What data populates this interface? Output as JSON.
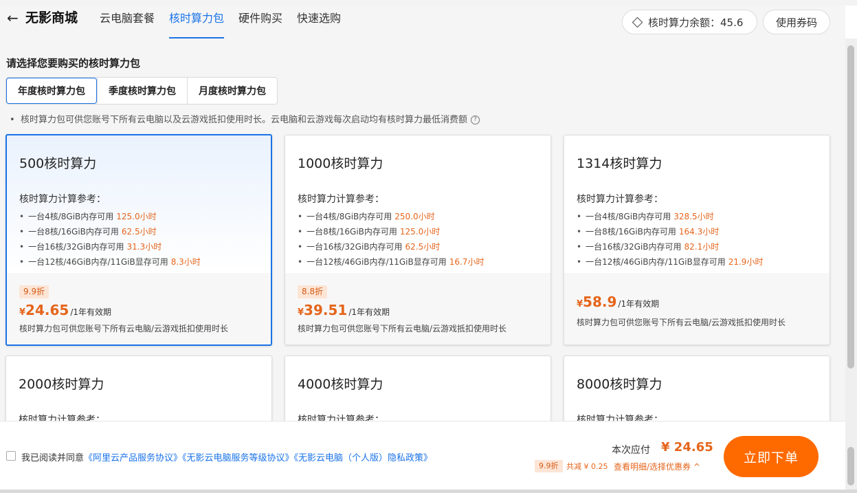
{
  "header": {
    "back_icon": "←",
    "brand": "无影商城",
    "tabs": [
      {
        "label": "云电脑套餐",
        "active": false
      },
      {
        "label": "核时算力包",
        "active": true
      },
      {
        "label": "硬件购买",
        "active": false
      },
      {
        "label": "快速选购",
        "active": false
      }
    ],
    "balance_label": "核时算力余额：45.6",
    "coupon_label": "使用券码"
  },
  "main": {
    "section_title": "请选择您要购买的核时算力包",
    "segments": [
      "年度核时算力包",
      "季度核时算力包",
      "月度核时算力包"
    ],
    "active_segment": 0,
    "note": "核时算力包可供您账号下所有云电脑以及云游戏抵扣使用时长。云电脑和云游戏每次启动均有核时算力最低消费额",
    "help_icon": "?",
    "card_ref_title": "核时算力计算参考：",
    "currency": "¥",
    "period": "/1年有效期",
    "card_desc": "核时算力包可供您账号下所有云电脑/云游戏抵扣使用时长",
    "cards": [
      {
        "title": "500核时算力",
        "items": [
          {
            "spec": "一台4核/8GiB内存可用",
            "hours": "125.0小时"
          },
          {
            "spec": "一台8核/16GiB内存可用",
            "hours": "62.5小时"
          },
          {
            "spec": "一台16核/32GiB内存可用",
            "hours": "31.3小时"
          },
          {
            "spec": "一台12核/46GiB内存/11GiB显存可用",
            "hours": "8.3小时"
          }
        ],
        "badge": "9.9折",
        "price": "24.65",
        "selected": true
      },
      {
        "title": "1000核时算力",
        "items": [
          {
            "spec": "一台4核/8GiB内存可用",
            "hours": "250.0小时"
          },
          {
            "spec": "一台8核/16GiB内存可用",
            "hours": "125.0小时"
          },
          {
            "spec": "一台16核/32GiB内存可用",
            "hours": "62.5小时"
          },
          {
            "spec": "一台12核/46GiB内存/11GiB显存可用",
            "hours": "16.7小时"
          }
        ],
        "badge": "8.8折",
        "price": "39.51",
        "selected": false
      },
      {
        "title": "1314核时算力",
        "items": [
          {
            "spec": "一台4核/8GiB内存可用",
            "hours": "328.5小时"
          },
          {
            "spec": "一台8核/16GiB内存可用",
            "hours": "164.3小时"
          },
          {
            "spec": "一台16核/32GiB内存可用",
            "hours": "82.1小时"
          },
          {
            "spec": "一台12核/46GiB内存/11GiB显存可用",
            "hours": "21.9小时"
          }
        ],
        "badge": "",
        "price": "58.9",
        "selected": false
      },
      {
        "title": "2000核时算力"
      },
      {
        "title": "4000核时算力"
      },
      {
        "title": "8000核时算力"
      }
    ]
  },
  "footer": {
    "agree_prefix": "我已阅读并同意",
    "links": [
      "《阿里云产品服务协议》",
      "《无影云电脑服务等级协议》",
      "《无影云电脑（个人版）隐私政策》"
    ],
    "pay_label": "本次应付",
    "pay_value": "¥ 24.65",
    "discount_badge": "9.9折",
    "save_text": "共减 ¥ 0.25",
    "detail_link": "查看明细/选择优惠券 ^",
    "order_button": "立即下单"
  },
  "colors": {
    "accent": "#1a73e8",
    "price": "#e5651b",
    "order_button": "#ff6a00",
    "badge_bg": "#fde5d6"
  },
  "icons": {
    "back": "arrow-left-icon",
    "balance": "diamond-icon",
    "help": "question-circle-icon"
  }
}
